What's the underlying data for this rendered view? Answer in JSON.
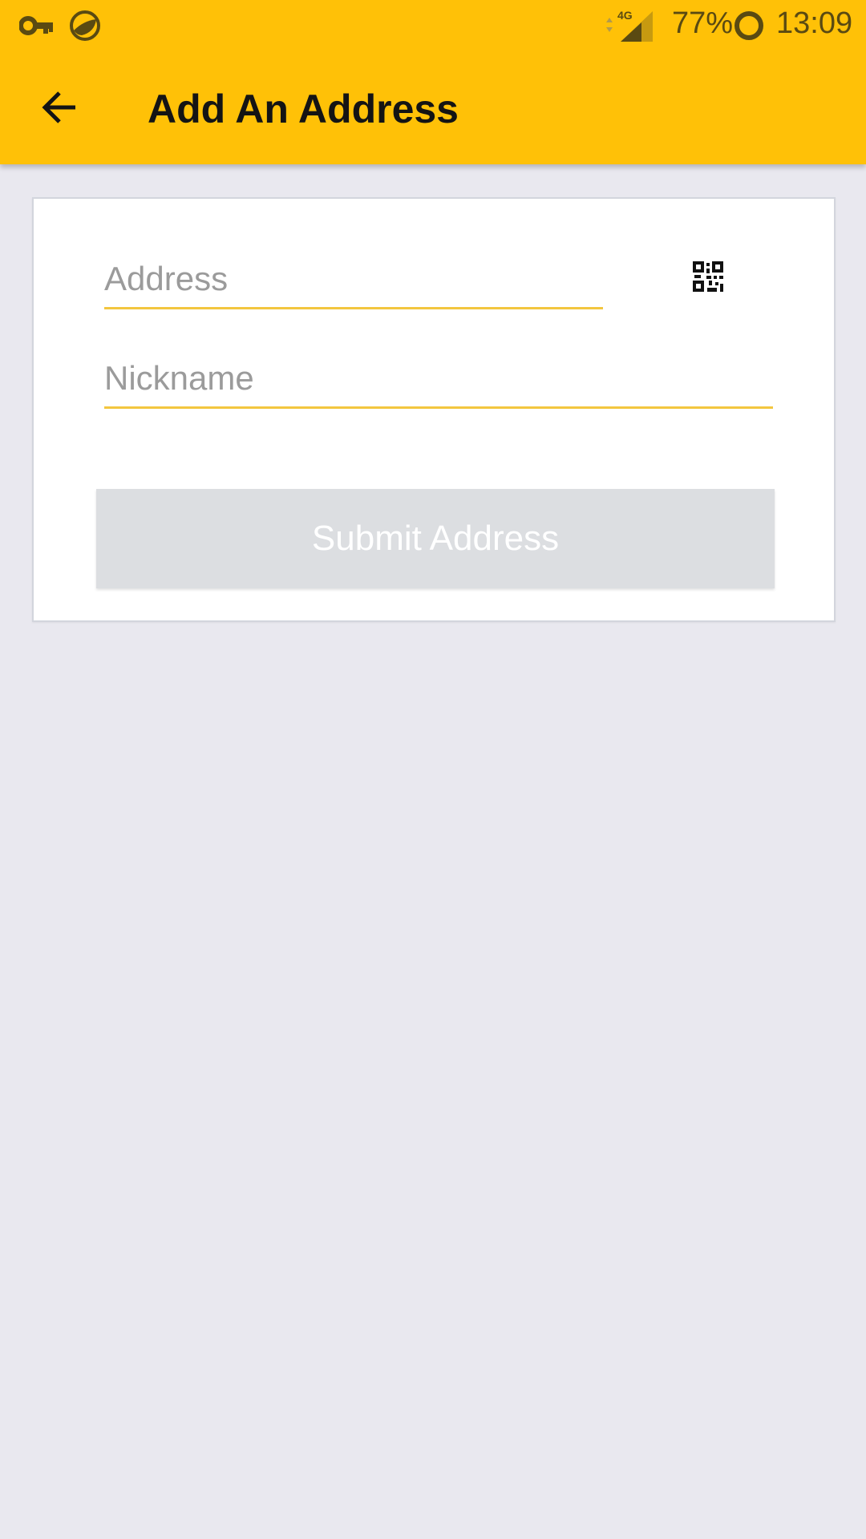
{
  "status_bar": {
    "left_icons": [
      "key-icon",
      "leaf-app-icon"
    ],
    "network_label": "4G",
    "battery_percent": "77%",
    "time": "13:09"
  },
  "app_bar": {
    "title": "Add An Address",
    "back_icon": "arrow-left-icon",
    "background_color": "#ffc107"
  },
  "form": {
    "address_placeholder": "Address",
    "address_value": "",
    "scan_icon": "qr-code-icon",
    "nickname_placeholder": "Nickname",
    "nickname_value": "",
    "underline_color": "#f3c63f",
    "submit_label": "Submit Address",
    "submit_enabled": false
  }
}
